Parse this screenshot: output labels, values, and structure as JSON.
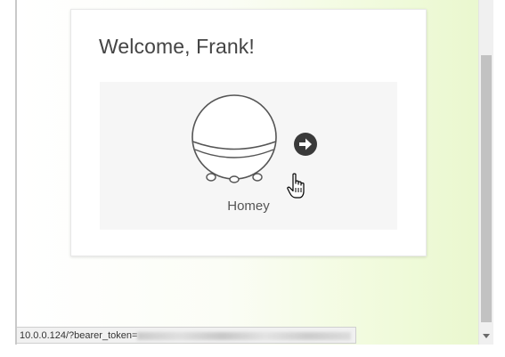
{
  "page": {
    "welcome_text": "Welcome, Frank!"
  },
  "device": {
    "name": "Homey",
    "illustration_icon": "homey-device-icon",
    "action_icon": "arrow-right-circle-icon"
  },
  "status_bar": {
    "url_prefix": "10.0.0.124/?bearer_token="
  },
  "cursor": {
    "icon": "hand-pointer-cursor-icon"
  },
  "colors": {
    "card_background": "#ffffff",
    "panel_background": "#f6f6f6",
    "action_button": "#3a3a3a",
    "text_primary": "#444444",
    "page_gradient_end": "#eaf8cf"
  }
}
